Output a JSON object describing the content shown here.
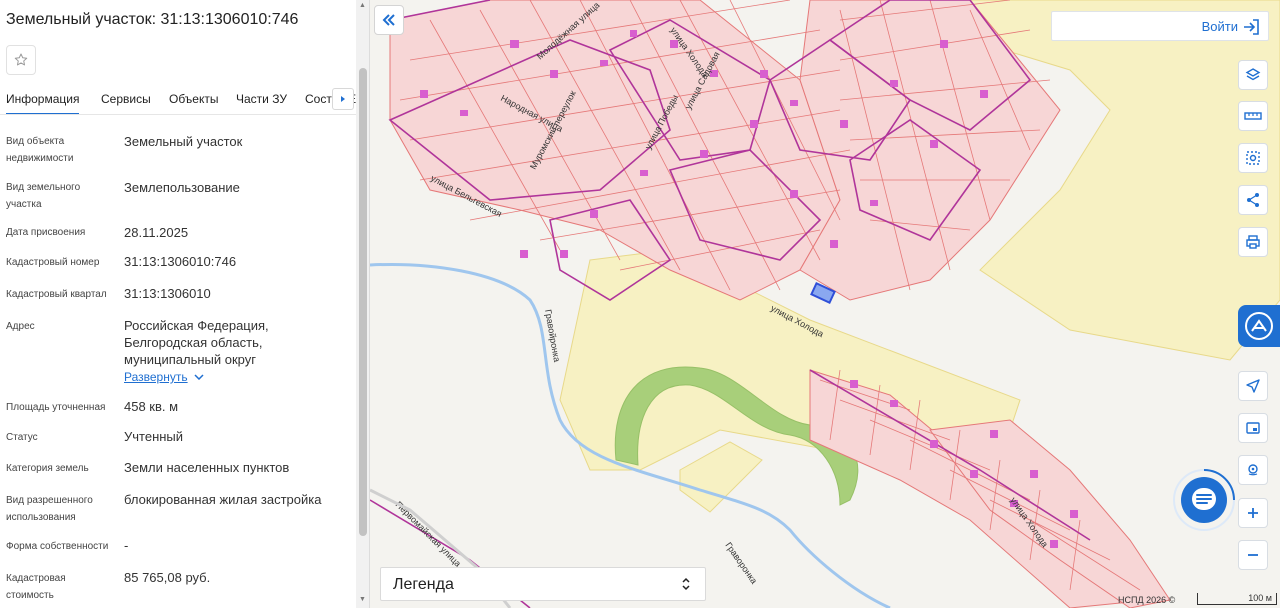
{
  "panel": {
    "title": "Земельный участок: 31:13:1306010:746",
    "tabs": [
      "Информация",
      "Сервисы",
      "Объекты",
      "Части ЗУ",
      "Состав ЕЗ"
    ],
    "fields": [
      {
        "label": "Вид объекта недвижимости",
        "value": "Земельный участок"
      },
      {
        "label": "Вид земельного участка",
        "value": "Землепользование"
      },
      {
        "label": "Дата присвоения",
        "value": "28.11.2025"
      },
      {
        "label": "Кадастровый номер",
        "value": "31:13:1306010:746"
      },
      {
        "label": "Кадастровый квартал",
        "value": "31:13:1306010"
      },
      {
        "label": "Адрес",
        "value": "Российская Федерация, Белгородская область, муниципальный округ"
      },
      {
        "label": "Площадь уточненная",
        "value": "458 кв. м"
      },
      {
        "label": "Статус",
        "value": "Учтенный"
      },
      {
        "label": "Категория земель",
        "value": "Земли населенных пунктов"
      },
      {
        "label": "Вид разрешенного использования",
        "value": "блокированная жилая застройка"
      },
      {
        "label": "Форма собственности",
        "value": "-"
      },
      {
        "label": "Кадастровая стоимость",
        "value": "85 765,08 руб."
      }
    ],
    "expand_label": "Развернуть"
  },
  "map": {
    "login_label": "Войти",
    "legend_label": "Легенда",
    "attribution": "НСПД 2026 ©",
    "scale_label": "100 м",
    "streets": [
      "улица Холода",
      "улица Холода",
      "улица Холода",
      "улица Победы",
      "улица Бельгевская",
      "Народная улица",
      "Муромский переулок",
      "улица Садовая",
      "Молодёжная улица",
      "Первомайская улица",
      "Гравойронка",
      "Граворонка"
    ],
    "tool_icons": [
      "layers-icon",
      "ruler-icon",
      "area-select-icon",
      "share-icon",
      "print-icon",
      "locate-icon",
      "screen-icon",
      "position-icon",
      "zoom-in-icon",
      "zoom-out-icon"
    ]
  },
  "colors": {
    "accent": "#1f6fd1",
    "parcel_fill": "#f7d6d6",
    "parcel_stroke": "#e57878",
    "quarter_border": "#b0359a",
    "building": "#d85ecf",
    "field_yellow": "#f7f1c3",
    "forest_green": "#a8cf7a",
    "river": "#9fc6ee"
  }
}
